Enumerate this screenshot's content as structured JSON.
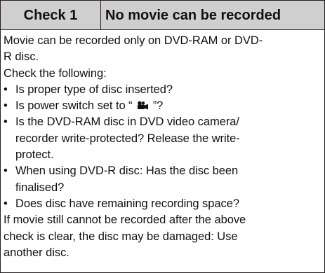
{
  "header": {
    "check_label": "Check 1",
    "title": "No movie can be recorded"
  },
  "body": {
    "intro_line_1": "Movie can be recorded only on DVD-RAM or DVD-",
    "intro_line_2": "R disc.",
    "check_following": "Check the following:",
    "bullets": [
      {
        "text_1": "Is proper type of disc inserted?"
      },
      {
        "text_before_icon": "Is power switch set to “",
        "icon": "movie-camera-icon",
        "text_after_icon": "”?"
      },
      {
        "text_1": "Is the DVD-RAM disc in DVD video camera/",
        "text_2": "recorder write-protected? Release the write-",
        "text_3": "protect."
      },
      {
        "text_1": "When using DVD-R disc: Has the disc been",
        "text_2": "finalised?"
      },
      {
        "text_1": "Does disc have remaining recording space?"
      }
    ],
    "closing_line_1": "If movie still cannot be recorded after the above",
    "closing_line_2": "check is clear, the disc may be damaged: Use",
    "closing_line_3": "another disc."
  }
}
